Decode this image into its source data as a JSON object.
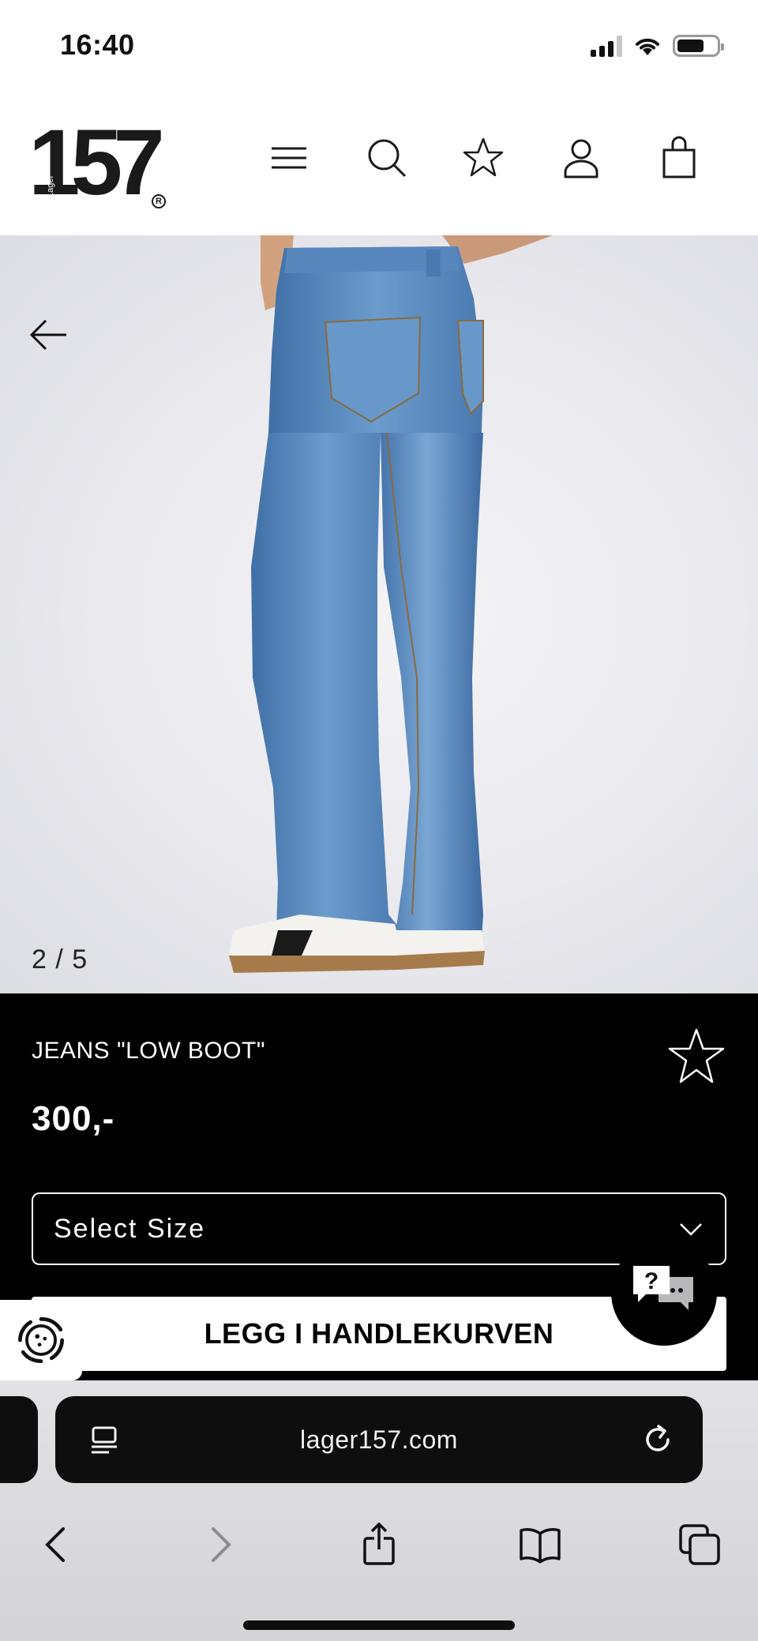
{
  "status_bar": {
    "time": "16:40"
  },
  "header": {
    "logo_number": "157",
    "logo_sub": "Lager",
    "logo_mark": "R",
    "icons": [
      "menu-icon",
      "search-icon",
      "star-icon",
      "user-icon",
      "bag-icon"
    ]
  },
  "product": {
    "image_counter": "2 / 5",
    "title": "JEANS \"LOW BOOT\"",
    "price": "300,-",
    "size_select": {
      "placeholder": "Select Size"
    },
    "add_to_cart_label": "LEGG I HANDLEKURVEN",
    "chat_glyph": "?"
  },
  "browser": {
    "url": "lager157.com"
  },
  "colors": {
    "accent_black": "#000000",
    "denim": "#5f8fc3",
    "background_light": "#ececf0"
  }
}
